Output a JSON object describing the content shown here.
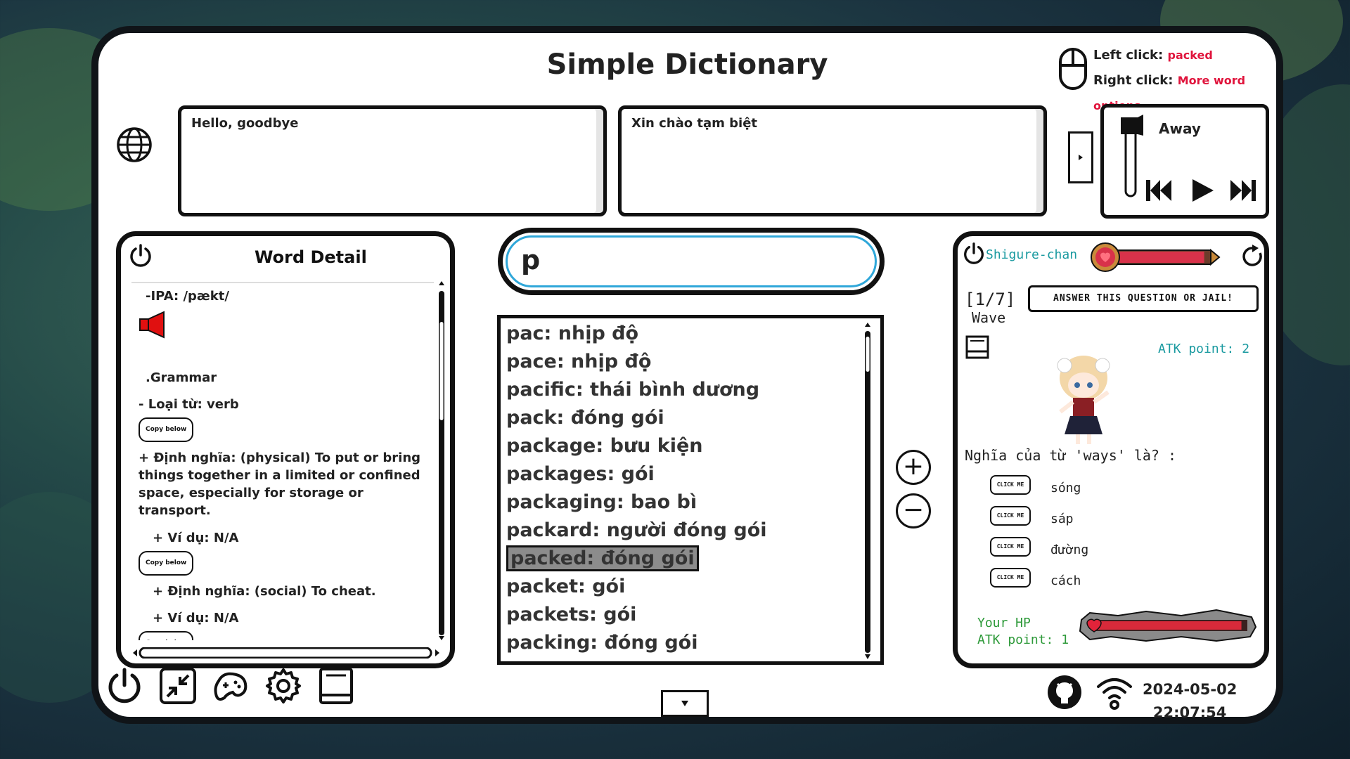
{
  "app": {
    "title": "Simple Dictionary"
  },
  "mouse_hint": {
    "left_label": "Left click:",
    "left_value": "packed",
    "right_label": "Right click:",
    "right_value": "More word options"
  },
  "translate": {
    "source_text": "Hello, goodbye",
    "target_text": "Xin chào tạm biệt"
  },
  "music": {
    "track": "Away"
  },
  "word_detail": {
    "title": "Word Detail",
    "ipa": "-IPA:  /pækt/",
    "grammar": ".Grammar",
    "pos": "-    Loại từ: verb",
    "copy_label": "Copy below",
    "def1": "+   Định nghĩa: (physical) To put or bring things together in a limited or confined space, especially for storage or transport.",
    "ex1": "+   Ví dụ: N/A",
    "def2": "+   Định nghĩa: (social) To cheat.",
    "ex2": "+   Ví dụ: N/A"
  },
  "search": {
    "value": "p"
  },
  "word_list": [
    "pac: nhịp độ",
    "pace: nhịp độ",
    "pacific: thái bình dương",
    "pack: đóng gói",
    "package: bưu kiện",
    "packages: gói",
    "packaging: bao bì",
    "packard: người đóng gói",
    "packed: đóng gói",
    "packet: gói",
    "packets: gói",
    "packing: đóng gói"
  ],
  "selected_index": 8,
  "zoom": {
    "in": "+",
    "out": "−"
  },
  "game": {
    "character": "Shigure-chan",
    "enemy_hp_fraction": 0.95,
    "wave": "[1/7]",
    "wave_label": "Wave",
    "speech": "ANSWER THIS QUESTION OR JAIL!",
    "enemy_atk": "ATK point: 2",
    "question": "Nghĩa của từ 'ways' là? :",
    "click_label": "CLICK ME",
    "options": [
      "sóng",
      "sáp",
      "đường",
      "cách"
    ],
    "your_hp": "Your HP",
    "your_atk": "ATK point: 1",
    "player_hp_fraction": 0.97
  },
  "datetime": {
    "date": "2024-05-02",
    "time": "22:07:54"
  },
  "colors": {
    "accent_red": "#e0143c",
    "search_border": "#2fa7d9",
    "game_teal": "#1a9aa0",
    "game_green": "#2e9a3a"
  }
}
